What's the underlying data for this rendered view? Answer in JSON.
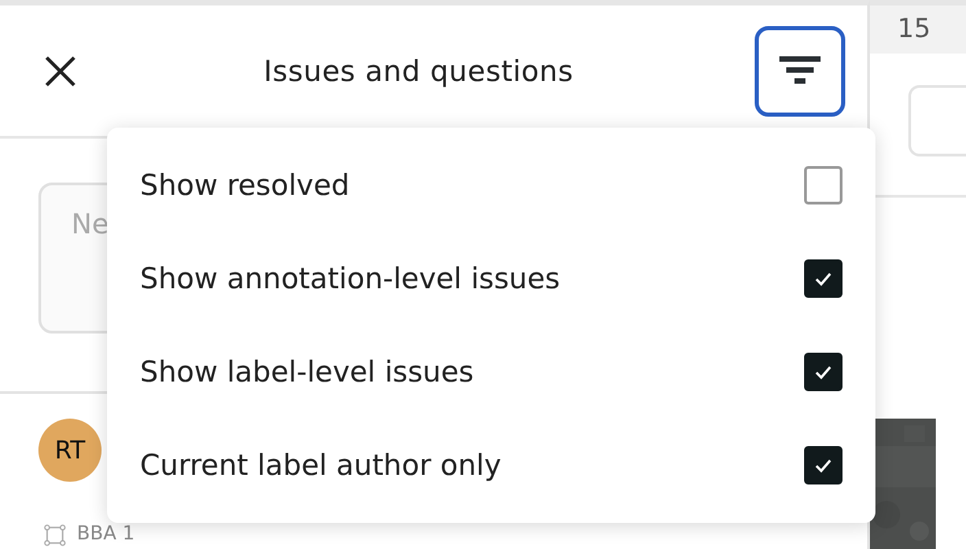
{
  "panel": {
    "title": "Issues and questions",
    "filter_active": true,
    "comment_placeholder": "Ne",
    "issue": {
      "avatar": "RT",
      "target": "BBA 1"
    }
  },
  "filter_menu": {
    "items": [
      {
        "label": "Show resolved",
        "checked": false
      },
      {
        "label": "Show annotation-level issues",
        "checked": true
      },
      {
        "label": "Show label-level issues",
        "checked": true
      },
      {
        "label": "Current label author only",
        "checked": true
      }
    ]
  },
  "side": {
    "header": "15"
  }
}
